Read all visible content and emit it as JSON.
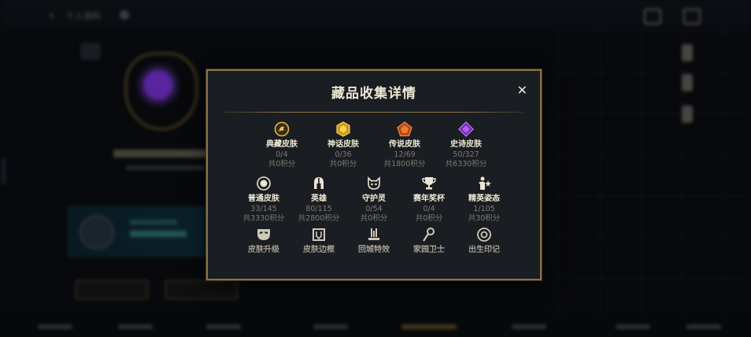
{
  "background": {
    "title": "个人资料",
    "back_icon": "chevron-left-icon"
  },
  "modal": {
    "title": "藏品收集详情",
    "close_label": "✕",
    "categories_row1": [
      {
        "name": "典藏皮肤",
        "count": "0/4",
        "points": "共0积分",
        "icon": "legendary-collection-icon",
        "color": "#e0b44a"
      },
      {
        "name": "神话皮肤",
        "count": "0/36",
        "points": "共0积分",
        "icon": "mythic-gem-icon",
        "color": "#f0c838"
      },
      {
        "name": "传说皮肤",
        "count": "12/69",
        "points": "共1800积分",
        "icon": "legend-gem-icon",
        "color": "#e06a2a"
      },
      {
        "name": "史诗皮肤",
        "count": "50/327",
        "points": "共6330积分",
        "icon": "epic-gem-icon",
        "color": "#a452e8"
      }
    ],
    "categories_row2": [
      {
        "name": "普通皮肤",
        "count": "33/145",
        "points": "共3330积分",
        "icon": "common-skin-icon"
      },
      {
        "name": "英雄",
        "count": "80/115",
        "points": "共2800积分",
        "icon": "helmet-icon"
      },
      {
        "name": "守护灵",
        "count": "0/54",
        "points": "共0积分",
        "icon": "guardian-spirit-icon"
      },
      {
        "name": "赛年奖杯",
        "count": "0/4",
        "points": "共0积分",
        "icon": "trophy-icon"
      },
      {
        "name": "精英姿态",
        "count": "1/105",
        "points": "共30积分",
        "icon": "elite-pose-icon"
      }
    ],
    "categories_row3": [
      {
        "name": "皮肤升级",
        "icon": "skin-upgrade-mask-icon"
      },
      {
        "name": "皮肤边框",
        "icon": "skin-frame-icon"
      },
      {
        "name": "回城特效",
        "icon": "recall-effect-icon"
      },
      {
        "name": "家园卫士",
        "icon": "home-guard-icon"
      },
      {
        "name": "出生印记",
        "icon": "birth-mark-icon"
      }
    ]
  }
}
